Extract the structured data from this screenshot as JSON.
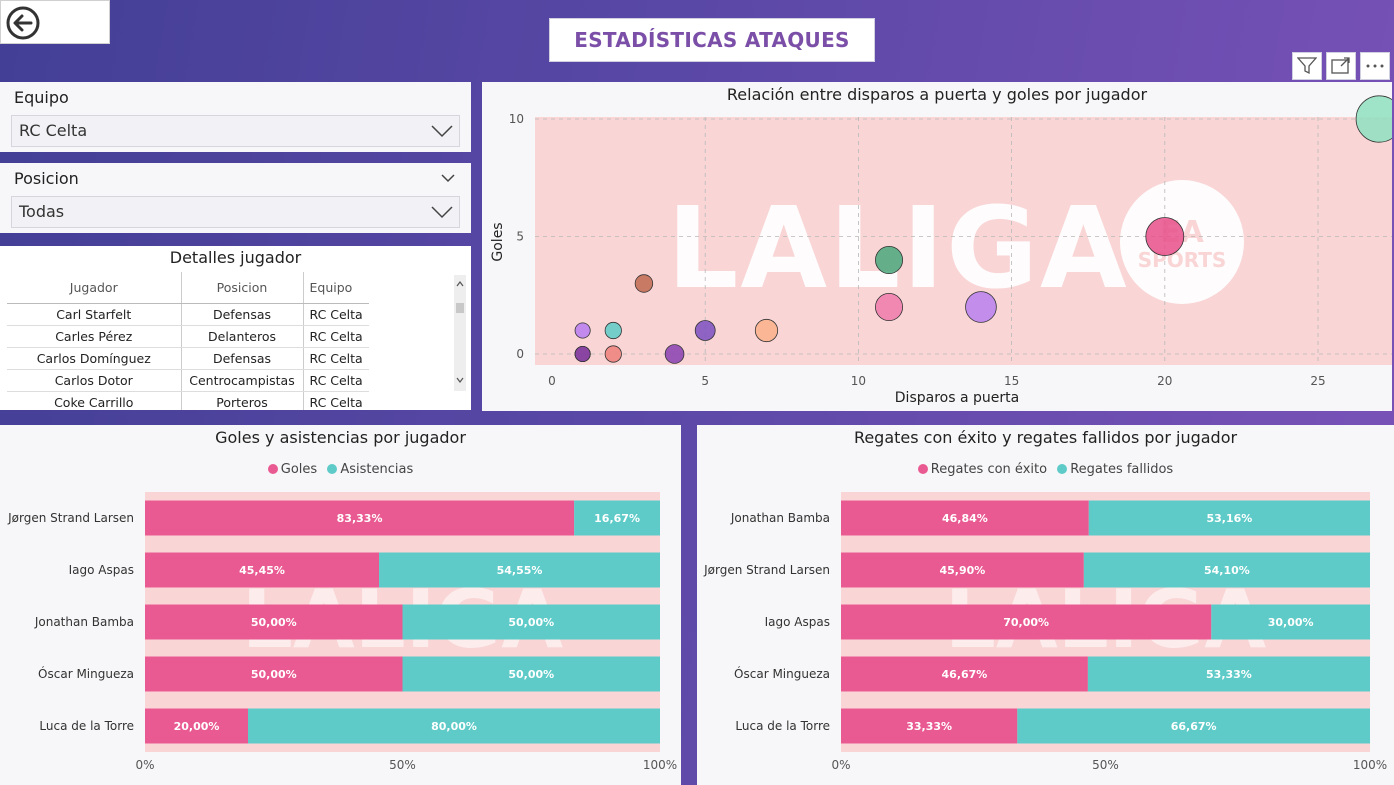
{
  "header": {
    "title": "ESTADÍSTICAS ATAQUES"
  },
  "filters": {
    "equipo": {
      "label": "Equipo",
      "value": "RC Celta"
    },
    "posicion": {
      "label": "Posicion",
      "value": "Todas"
    }
  },
  "details": {
    "title": "Detalles jugador",
    "columns": [
      "Jugador",
      "Posicion",
      "Equipo"
    ],
    "rows": [
      [
        "Carl Starfelt",
        "Defensas",
        "RC Celta"
      ],
      [
        "Carles Pérez",
        "Delanteros",
        "RC Celta"
      ],
      [
        "Carlos Domínguez",
        "Defensas",
        "RC Celta"
      ],
      [
        "Carlos Dotor",
        "Centrocampistas",
        "RC Celta"
      ],
      [
        "Coke Carrillo",
        "Porteros",
        "RC Celta"
      ]
    ]
  },
  "colors": {
    "pink": "#ea5a92",
    "teal": "#5ecbc8",
    "plot_bg": "#f9d5d6"
  },
  "watermark": {
    "brand": "LALIGA",
    "sponsor_top": "EA",
    "sponsor_bottom": "SPORTS"
  },
  "chart_data": [
    {
      "type": "scatter",
      "title": "Relación entre disparos a puerta y goles por jugador",
      "xlabel": "Disparos a puerta",
      "ylabel": "Goles",
      "xlim": [
        0,
        27
      ],
      "ylim": [
        0,
        10
      ],
      "xticks": [
        0,
        5,
        10,
        15,
        20,
        25
      ],
      "yticks": [
        0,
        5,
        10
      ],
      "grid": true,
      "points": [
        {
          "x": 1,
          "y": 0,
          "color": "#9d5fd0"
        },
        {
          "x": 1,
          "y": 0,
          "color": "#e05a8a"
        },
        {
          "x": 1,
          "y": 0,
          "color": "#7b3fa5"
        },
        {
          "x": 1,
          "y": 1,
          "color": "#b77cf0"
        },
        {
          "x": 2,
          "y": 0,
          "color": "#f0807a"
        },
        {
          "x": 2,
          "y": 1,
          "color": "#5ecbc8"
        },
        {
          "x": 3,
          "y": 3,
          "color": "#c06a50"
        },
        {
          "x": 4,
          "y": 0,
          "color": "#8a3fb0"
        },
        {
          "x": 5,
          "y": 1,
          "color": "#7b4fc0"
        },
        {
          "x": 7,
          "y": 1,
          "color": "#fbb08a"
        },
        {
          "x": 11,
          "y": 4,
          "color": "#4aa77c"
        },
        {
          "x": 11,
          "y": 2,
          "color": "#f07aab"
        },
        {
          "x": 14,
          "y": 2,
          "color": "#b980ef"
        },
        {
          "x": 20,
          "y": 5,
          "color": "#e8508a"
        },
        {
          "x": 27,
          "y": 10,
          "color": "#8fe0c0"
        }
      ]
    },
    {
      "type": "bar",
      "stacked": "100%",
      "title": "Goles y asistencias por jugador",
      "categories": [
        "Jørgen Strand Larsen",
        "Iago Aspas",
        "Jonathan Bamba",
        "Óscar Mingueza",
        "Luca de la Torre"
      ],
      "series": [
        {
          "name": "Goles",
          "values": [
            83.33,
            45.45,
            50.0,
            50.0,
            20.0
          ],
          "labels": [
            "83,33%",
            "45,45%",
            "50,00%",
            "50,00%",
            "20,00%"
          ]
        },
        {
          "name": "Asistencias",
          "values": [
            16.67,
            54.55,
            50.0,
            50.0,
            80.0
          ],
          "labels": [
            "16,67%",
            "54,55%",
            "50,00%",
            "50,00%",
            "80,00%"
          ]
        }
      ],
      "xticks": [
        "0%",
        "50%",
        "100%"
      ],
      "legend": "top-center"
    },
    {
      "type": "bar",
      "stacked": "100%",
      "title": "Regates con éxito y regates fallidos por jugador",
      "categories": [
        "Jonathan Bamba",
        "Jørgen Strand Larsen",
        "Iago Aspas",
        "Óscar Mingueza",
        "Luca de la Torre"
      ],
      "series": [
        {
          "name": "Regates con éxito",
          "values": [
            46.84,
            45.9,
            70.0,
            46.67,
            33.33
          ],
          "labels": [
            "46,84%",
            "45,90%",
            "70,00%",
            "46,67%",
            "33,33%"
          ]
        },
        {
          "name": "Regates fallidos",
          "values": [
            53.16,
            54.1,
            30.0,
            53.33,
            66.67
          ],
          "labels": [
            "53,16%",
            "54,10%",
            "30,00%",
            "53,33%",
            "66,67%"
          ]
        }
      ],
      "xticks": [
        "0%",
        "50%",
        "100%"
      ],
      "legend": "top-center"
    }
  ]
}
